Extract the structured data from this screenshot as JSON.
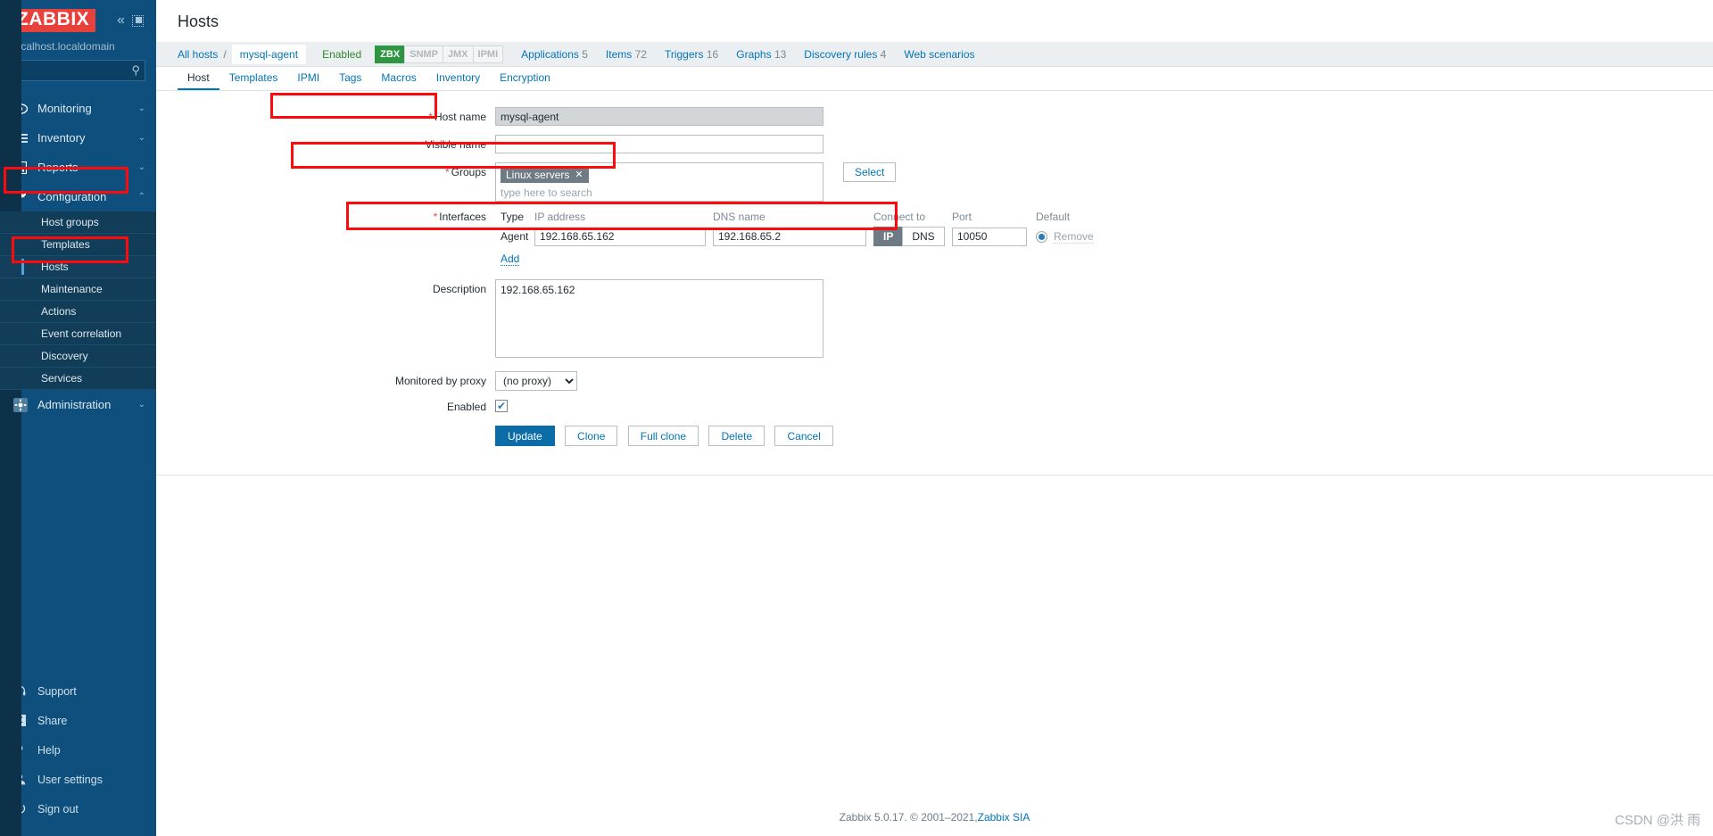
{
  "sidebar": {
    "logo": "ZABBIX",
    "collapse_icon": "chevron-double-left-icon",
    "hide_icon": "hide-sidebar-icon",
    "server": "localhost.localdomain",
    "search": {
      "value": "",
      "placeholder": ""
    },
    "menu": [
      {
        "label": "Monitoring",
        "icon": "eye-icon",
        "caret": "⌄"
      },
      {
        "label": "Inventory",
        "icon": "list-icon",
        "caret": "⌄"
      },
      {
        "label": "Reports",
        "icon": "bar-chart-icon",
        "caret": "⌄"
      },
      {
        "label": "Configuration",
        "icon": "wrench-icon",
        "caret": "⌃"
      },
      {
        "label": "Administration",
        "icon": "gear-icon",
        "caret": "⌄"
      }
    ],
    "submenu": [
      "Host groups",
      "Templates",
      "Hosts",
      "Maintenance",
      "Actions",
      "Event correlation",
      "Discovery",
      "Services"
    ],
    "selected_submenu": "Hosts",
    "bottom": [
      {
        "label": "Support",
        "icon": "headset-icon"
      },
      {
        "label": "Share",
        "icon": "zabbix-share-icon"
      },
      {
        "label": "Help",
        "icon": "question-icon"
      },
      {
        "label": "User settings",
        "icon": "user-icon"
      },
      {
        "label": "Sign out",
        "icon": "power-icon"
      }
    ]
  },
  "header": {
    "title": "Hosts"
  },
  "breadcrumb": {
    "all_hosts": "All hosts",
    "separator": "/",
    "current": "mysql-agent",
    "status": "Enabled",
    "protocols": [
      {
        "label": "ZBX",
        "active": true
      },
      {
        "label": "SNMP",
        "active": false
      },
      {
        "label": "JMX",
        "active": false
      },
      {
        "label": "IPMI",
        "active": false
      }
    ],
    "links": [
      {
        "label": "Applications",
        "count": "5"
      },
      {
        "label": "Items",
        "count": "72"
      },
      {
        "label": "Triggers",
        "count": "16"
      },
      {
        "label": "Graphs",
        "count": "13"
      },
      {
        "label": "Discovery rules",
        "count": "4"
      },
      {
        "label": "Web scenarios",
        "count": ""
      }
    ]
  },
  "tabs": [
    {
      "label": "Host",
      "active": true
    },
    {
      "label": "Templates",
      "active": false
    },
    {
      "label": "IPMI",
      "active": false
    },
    {
      "label": "Tags",
      "active": false
    },
    {
      "label": "Macros",
      "active": false
    },
    {
      "label": "Inventory",
      "active": false
    },
    {
      "label": "Encryption",
      "active": false
    }
  ],
  "form": {
    "host_name": {
      "label": "Host name",
      "required": true,
      "value": "mysql-agent"
    },
    "visible_name": {
      "label": "Visible name",
      "required": false,
      "value": "",
      "placeholder": ""
    },
    "groups": {
      "label": "Groups",
      "required": true,
      "chips": [
        {
          "label": "Linux servers",
          "remove_icon": "close-icon"
        }
      ],
      "placeholder": "type here to search",
      "select_button": "Select"
    },
    "interfaces": {
      "label": "Interfaces",
      "required": true,
      "columns": [
        "Type",
        "IP address",
        "DNS name",
        "Connect to",
        "Port",
        "Default"
      ],
      "rows": [
        {
          "type": "Agent",
          "ip": "192.168.65.162",
          "dns": "192.168.65.2",
          "connect_to": {
            "options": [
              "IP",
              "DNS"
            ],
            "selected": "IP"
          },
          "port": "10050",
          "default_selected": true,
          "remove_label": "Remove"
        }
      ],
      "add_link": "Add"
    },
    "description": {
      "label": "Description",
      "value": "192.168.65.162"
    },
    "proxy": {
      "label": "Monitored by proxy",
      "selected": "(no proxy)",
      "options": [
        "(no proxy)"
      ]
    },
    "enabled": {
      "label": "Enabled",
      "checked": true,
      "check_glyph": "✔"
    },
    "buttons": [
      {
        "label": "Update",
        "style": "primary"
      },
      {
        "label": "Clone",
        "style": "ghost"
      },
      {
        "label": "Full clone",
        "style": "ghost"
      },
      {
        "label": "Delete",
        "style": "ghost"
      },
      {
        "label": "Cancel",
        "style": "ghost"
      }
    ]
  },
  "footer": {
    "product": "Zabbix 5.0.17. © 2001–2021, ",
    "link": "Zabbix SIA",
    "watermark": "CSDN @洪 雨"
  },
  "colors": {
    "brand_red": "#e8403a",
    "sidebar": "#0e4f7d",
    "link": "#0275b8",
    "annotation": "#fb0b0b",
    "status_green": "#2e8b2e"
  }
}
